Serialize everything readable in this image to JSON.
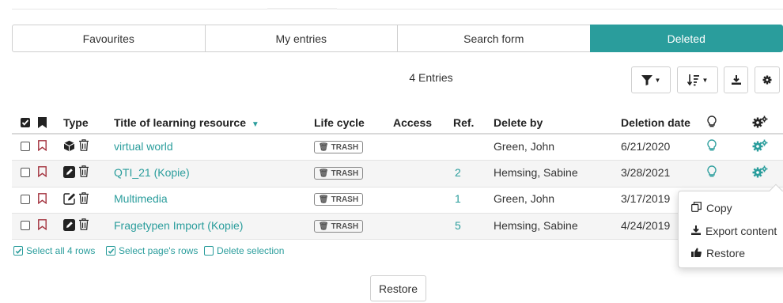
{
  "tabs": [
    {
      "label": "Favourites",
      "active": false
    },
    {
      "label": "My entries",
      "active": false
    },
    {
      "label": "Search form",
      "active": false
    },
    {
      "label": "Deleted",
      "active": true
    }
  ],
  "entries_count": "4 Entries",
  "toolbar": {
    "filter_icon": "filter-icon",
    "sort_icon": "sort-icon",
    "download_icon": "download-icon",
    "settings_icon": "gear-icon"
  },
  "table": {
    "headers": {
      "type": "Type",
      "title": "Title of learning resource",
      "lifecycle": "Life cycle",
      "access": "Access",
      "ref": "Ref.",
      "deleted_by": "Delete by",
      "deletion_date": "Deletion date"
    },
    "rows": [
      {
        "type_icon": "cube-icon",
        "title": "virtual world",
        "lifecycle": "TRASH",
        "access": "",
        "ref": "",
        "deleted_by": "Green, John",
        "deletion_date": "6/21/2020"
      },
      {
        "type_icon": "pencil-square-icon",
        "title": "QTI_21 (Kopie)",
        "lifecycle": "TRASH",
        "access": "",
        "ref": "2",
        "deleted_by": "Hemsing, Sabine",
        "deletion_date": "3/28/2021"
      },
      {
        "type_icon": "edit-square-icon",
        "title": "Multimedia",
        "lifecycle": "TRASH",
        "access": "",
        "ref": "1",
        "deleted_by": "Green, John",
        "deletion_date": "3/17/2019"
      },
      {
        "type_icon": "pencil-square-icon",
        "title": "Fragetypen Import (Kopie)",
        "lifecycle": "TRASH",
        "access": "",
        "ref": "5",
        "deleted_by": "Hemsing, Sabine",
        "deletion_date": "4/24/2019"
      }
    ]
  },
  "footer": {
    "select_all": "Select all 4 rows",
    "select_page": "Select page's rows",
    "delete_selection": "Delete selection"
  },
  "restore_button": "Restore",
  "popover_menu": {
    "items": [
      "Copy",
      "Export content",
      "Restore"
    ]
  },
  "colors": {
    "accent": "#2a9d9c",
    "trash_border": "#888888",
    "bookmark": "#a3323e"
  }
}
